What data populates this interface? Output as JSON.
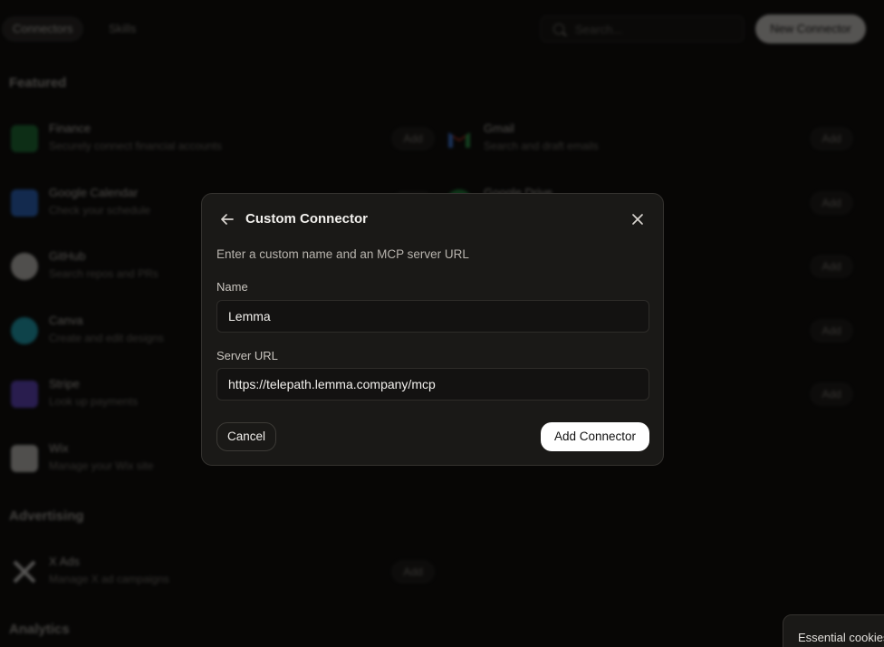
{
  "header": {
    "tabs": [
      {
        "label": "Connectors",
        "active": true
      },
      {
        "label": "Skills",
        "active": false
      }
    ],
    "search_placeholder": "Search...",
    "new_connector_label": "New Connector"
  },
  "sections": {
    "featured": "Featured",
    "advertising": "Advertising",
    "analytics": "Analytics"
  },
  "connectors": {
    "add_label": "Add",
    "left": [
      {
        "name": "Finance",
        "desc": "Securely connect financial accounts",
        "icon": "bank-icon",
        "color": "#1e7a3a"
      },
      {
        "name": "Google Calendar",
        "desc": "Check your schedule",
        "icon": "calendar-icon",
        "color": "#2f6fd6"
      },
      {
        "name": "GitHub",
        "desc": "Search repos and PRs",
        "icon": "github-icon",
        "color": "#e8e6e3"
      },
      {
        "name": "Canva",
        "desc": "Create and edit designs",
        "icon": "canva-icon",
        "color": "#1fb3c8"
      },
      {
        "name": "Stripe",
        "desc": "Look up payments",
        "icon": "stripe-icon",
        "color": "#6a4bd6"
      },
      {
        "name": "Wix",
        "desc": "Manage your Wix site",
        "icon": "wix-icon",
        "color": "#d8d6d2"
      }
    ],
    "right": [
      {
        "name": "Gmail",
        "desc": "Search and draft emails",
        "icon": "gmail-icon",
        "color": "#e2432f"
      },
      {
        "name": "Google Drive",
        "desc": "",
        "icon": "drive-icon",
        "color": "#1e8e3e"
      }
    ],
    "advertising": [
      {
        "name": "X Ads",
        "desc": "Manage X ad campaigns",
        "icon": "x-icon",
        "color": "#e8e6e3"
      }
    ]
  },
  "dialog": {
    "title": "Custom Connector",
    "subtitle": "Enter a custom name and an MCP server URL",
    "name_label": "Name",
    "name_value": "Lemma",
    "url_label": "Server URL",
    "url_value": "https://telepath.lemma.company/mcp",
    "cancel_label": "Cancel",
    "submit_label": "Add Connector"
  },
  "cookie_banner": {
    "text": "Essential cookies"
  }
}
